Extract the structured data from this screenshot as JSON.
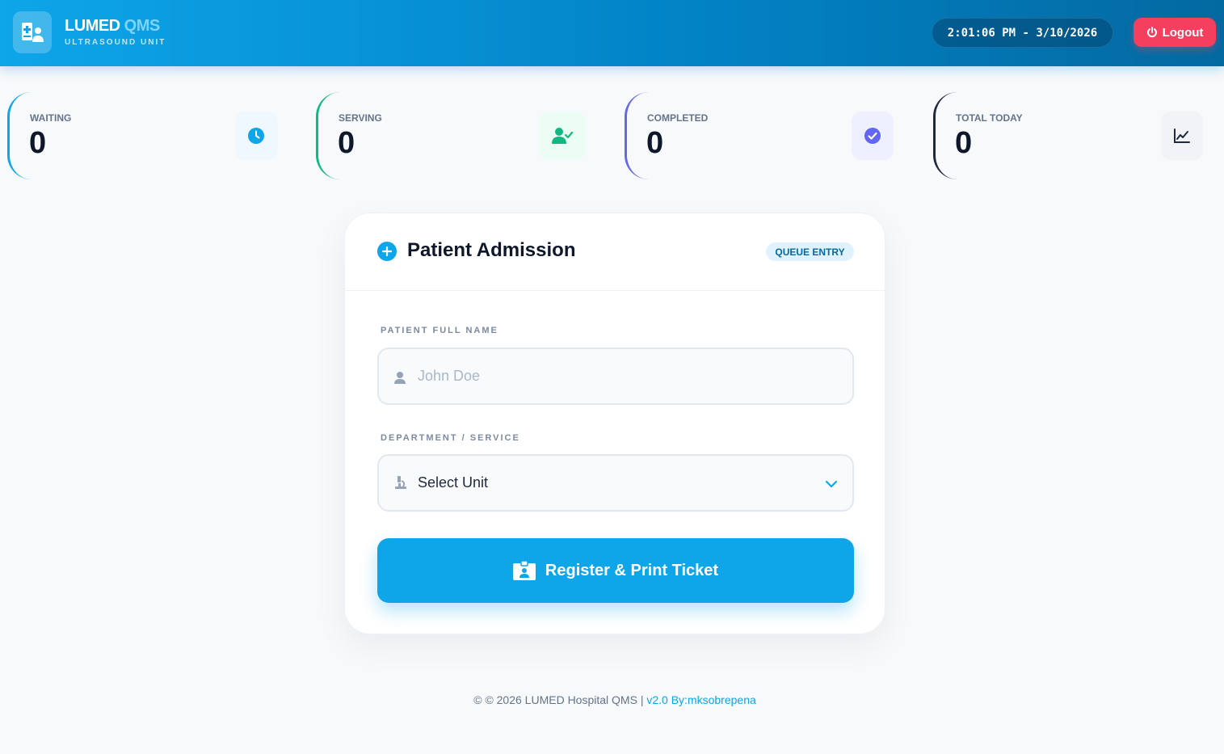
{
  "header": {
    "brand_main": "LUMED",
    "brand_accent": "QMS",
    "subtitle": "ULTRASOUND UNIT",
    "clock": "2:01:06 PM - 3/10/2026",
    "logout_label": "Logout"
  },
  "stats": [
    {
      "label": "WAITING",
      "value": "0",
      "color": "#0ea5e9",
      "icon": "clock-icon"
    },
    {
      "label": "SERVING",
      "value": "0",
      "color": "#10b981",
      "icon": "user-check-icon"
    },
    {
      "label": "COMPLETED",
      "value": "0",
      "color": "#6366f1",
      "icon": "check-circle-icon"
    },
    {
      "label": "TOTAL TODAY",
      "value": "0",
      "color": "#1e293b",
      "icon": "chart-line-icon"
    }
  ],
  "admission": {
    "title": "Patient Admission",
    "badge": "QUEUE ENTRY",
    "name_label": "PATIENT FULL NAME",
    "name_placeholder": "John Doe",
    "name_value": "",
    "dept_label": "DEPARTMENT / SERVICE",
    "dept_selected": "Select Unit",
    "submit_label": "Register & Print Ticket"
  },
  "footer": {
    "copyright": "© © 2026 LUMED Hospital QMS",
    "separator": "|",
    "version": "v2.0 By:mksobrepena"
  }
}
